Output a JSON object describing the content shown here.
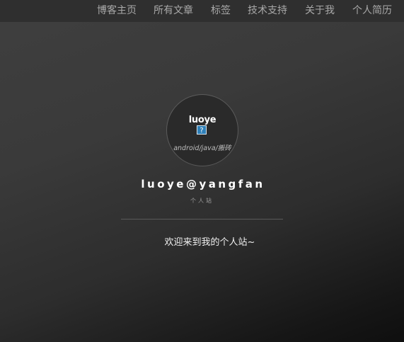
{
  "nav": {
    "items": [
      {
        "label": "博客主页"
      },
      {
        "label": "所有文章"
      },
      {
        "label": "标签"
      },
      {
        "label": "技术支持"
      },
      {
        "label": "关于我"
      },
      {
        "label": "个人简历"
      }
    ]
  },
  "avatar": {
    "name": "luoye",
    "image_placeholder": "?",
    "subtitle": "android/java/搬砖"
  },
  "site": {
    "title": "luoye@yangfan",
    "subtitle": "个人站",
    "welcome": "欢迎来到我的个人站~"
  },
  "colors": {
    "nav_bg": "#2f2f2f",
    "nav_text": "#a9a9a9",
    "page_bg": "#333333",
    "text": "#ffffff"
  }
}
